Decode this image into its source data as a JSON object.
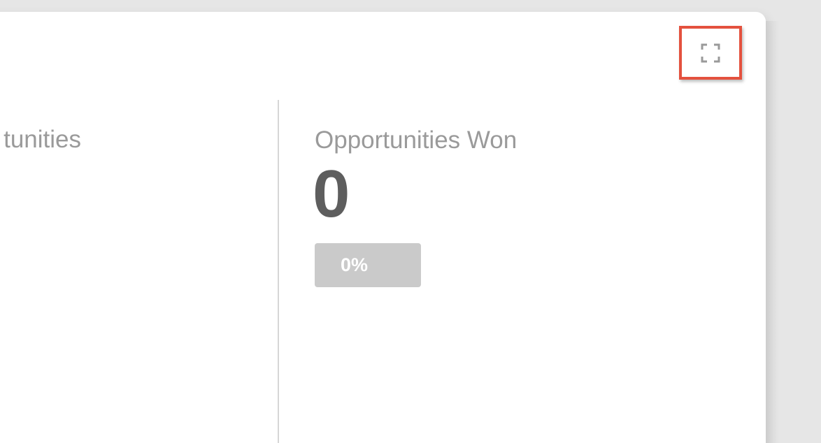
{
  "widget": {
    "expand_icon": "fullscreen-icon",
    "accent_color": "#e4513e",
    "left_column": {
      "title": "tunities"
    },
    "right_column": {
      "title": "Opportunities Won",
      "value": "0",
      "percent": "0%"
    }
  }
}
